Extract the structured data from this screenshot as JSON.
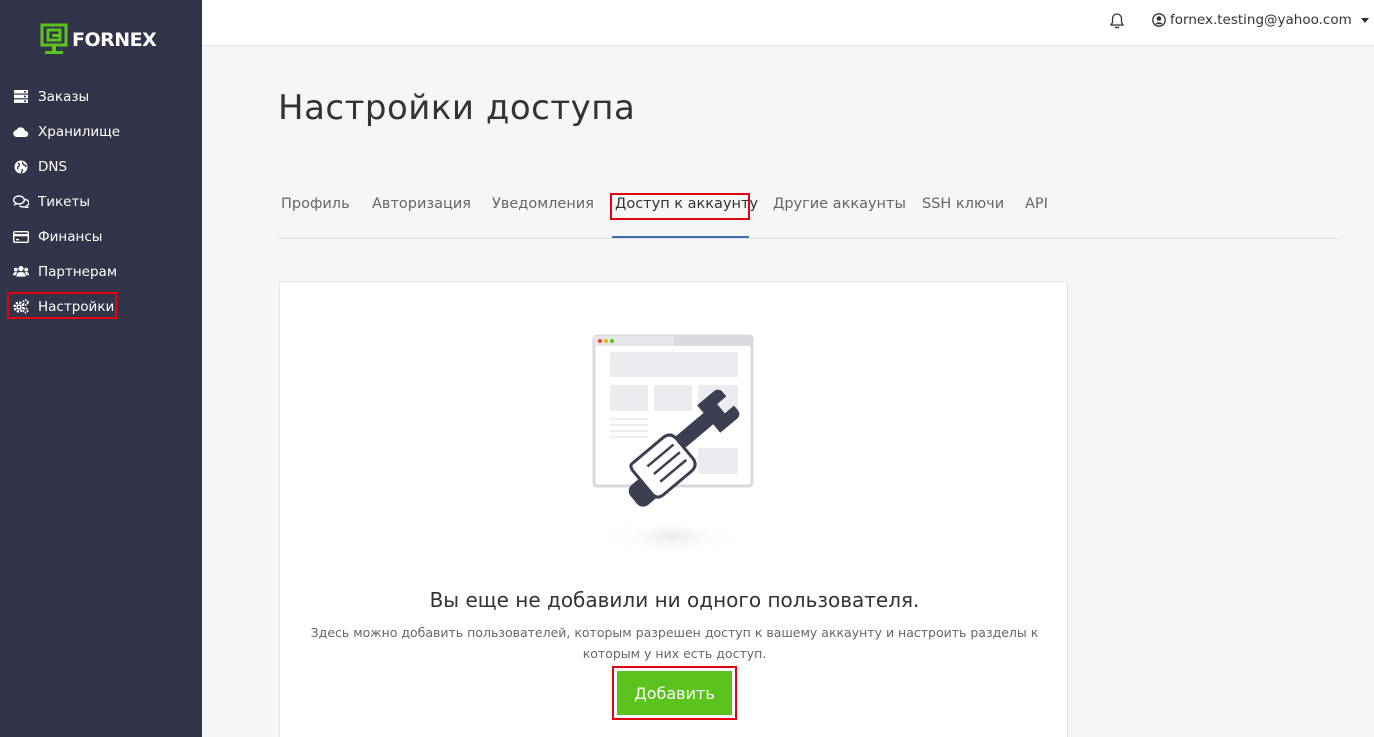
{
  "brand": {
    "name": "FORNEX",
    "accent": "#5cc21d",
    "sidebar_bg": "#32354a",
    "highlight": "#e3000f"
  },
  "sidebar": {
    "items": [
      {
        "label": "Заказы",
        "icon": "server-icon"
      },
      {
        "label": "Хранилище",
        "icon": "cloud-icon"
      },
      {
        "label": "DNS",
        "icon": "globe-icon"
      },
      {
        "label": "Тикеты",
        "icon": "comments-icon"
      },
      {
        "label": "Финансы",
        "icon": "credit-card-icon"
      },
      {
        "label": "Партнерам",
        "icon": "users-icon"
      },
      {
        "label": "Настройки",
        "icon": "gears-icon",
        "active": true
      }
    ]
  },
  "topbar": {
    "user_email": "fornex.testing@yahoo.com"
  },
  "main": {
    "title": "Настройки доступа",
    "tabs": [
      {
        "label": "Профиль"
      },
      {
        "label": "Авторизация"
      },
      {
        "label": "Уведомления"
      },
      {
        "label": "Доступ к аккаунту",
        "active": true
      },
      {
        "label": "Другие аккаунты"
      },
      {
        "label": "SSH ключи"
      },
      {
        "label": "API"
      }
    ],
    "empty_state": {
      "title": "Вы еще не добавили ни одного пользователя.",
      "description": "Здесь можно добавить пользователей, которым разрешен доступ к вашему аккаунту и настроить разделы к которым у них есть доступ.",
      "button_label": "Добавить"
    }
  }
}
